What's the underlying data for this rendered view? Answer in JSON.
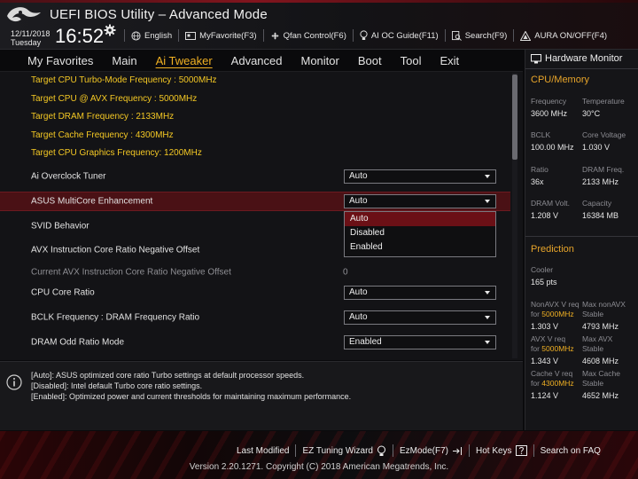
{
  "header": {
    "title": "UEFI BIOS Utility – Advanced Mode",
    "date": "12/11/2018",
    "day": "Tuesday",
    "time": "16:52",
    "items": [
      {
        "label": "English",
        "icon": "globe-icon"
      },
      {
        "label": "MyFavorite(F3)",
        "icon": "favorite-icon"
      },
      {
        "label": "Qfan Control(F6)",
        "icon": "fan-icon"
      },
      {
        "label": "AI OC Guide(F11)",
        "icon": "bulb-icon"
      },
      {
        "label": "Search(F9)",
        "icon": "search-icon"
      },
      {
        "label": "AURA ON/OFF(F4)",
        "icon": "aura-icon"
      }
    ]
  },
  "nav": {
    "tabs": [
      "My Favorites",
      "Main",
      "Ai Tweaker",
      "Advanced",
      "Monitor",
      "Boot",
      "Tool",
      "Exit"
    ],
    "active": "Ai Tweaker"
  },
  "main": {
    "info_lines": [
      "Target CPU Turbo-Mode Frequency : 5000MHz",
      "Target CPU @ AVX Frequency : 5000MHz",
      "Target DRAM Frequency : 2133MHz",
      "Target Cache Frequency : 4300MHz",
      "Target CPU Graphics Frequency: 1200MHz"
    ],
    "settings": [
      {
        "label": "Ai Overclock Tuner",
        "value": "Auto"
      },
      {
        "label": "ASUS MultiCore Enhancement",
        "value": "Auto"
      },
      {
        "label": "SVID Behavior",
        "value": ""
      },
      {
        "label": "AVX Instruction Core Ratio Negative Offset",
        "value": ""
      },
      {
        "label": "Current AVX Instruction Core Ratio Negative Offset",
        "value": "0"
      },
      {
        "label": "CPU Core Ratio",
        "value": "Auto"
      },
      {
        "label": "BCLK Frequency : DRAM Frequency Ratio",
        "value": "Auto"
      },
      {
        "label": "DRAM Odd Ratio Mode",
        "value": "Enabled"
      }
    ],
    "dropdown_options": [
      "Auto",
      "Disabled",
      "Enabled"
    ],
    "dropdown_selected": "Auto"
  },
  "help": [
    "[Auto]: ASUS optimized core ratio Turbo settings at default processor speeds.",
    "[Disabled]: Intel default Turbo core ratio settings.",
    "[Enabled]: Optimized power and current thresholds for maintaining maximum performance."
  ],
  "hw_monitor": {
    "title": "Hardware Monitor",
    "cpu_memory_label": "CPU/Memory",
    "cpu": [
      {
        "k": "Frequency",
        "v": "3600 MHz"
      },
      {
        "k": "Temperature",
        "v": "30°C"
      },
      {
        "k": "BCLK",
        "v": "100.00 MHz"
      },
      {
        "k": "Core Voltage",
        "v": "1.030 V"
      },
      {
        "k": "Ratio",
        "v": "36x"
      },
      {
        "k": "DRAM Freq.",
        "v": "2133 MHz"
      },
      {
        "k": "DRAM Volt.",
        "v": "1.208 V"
      },
      {
        "k": "Capacity",
        "v": "16384 MB"
      }
    ],
    "prediction_label": "Prediction",
    "cooler_label": "Cooler",
    "cooler_value": "165 pts",
    "pred": [
      {
        "k1": "NonAVX V req",
        "k2": "for ",
        "k2hl": "5000MHz",
        "v": "1.303 V"
      },
      {
        "k1": "Max nonAVX",
        "k2": "Stable",
        "k2hl": "",
        "v": "4793 MHz"
      },
      {
        "k1": "AVX V req",
        "k2": "for ",
        "k2hl": "5000MHz",
        "v": "1.343 V"
      },
      {
        "k1": "Max AVX",
        "k2": "Stable",
        "k2hl": "",
        "v": "4608 MHz"
      },
      {
        "k1": "Cache V req",
        "k2": "for ",
        "k2hl": "4300MHz",
        "v": "1.124 V"
      },
      {
        "k1": "Max Cache",
        "k2": "Stable",
        "k2hl": "",
        "v": "4652 MHz"
      }
    ]
  },
  "footer": {
    "items": [
      "Last Modified",
      "EZ Tuning Wizard",
      "EzMode(F7)",
      "Hot Keys",
      "Search on FAQ"
    ],
    "copyright": "Version 2.20.1271. Copyright (C) 2018 American Megatrends, Inc."
  },
  "colors": {
    "accent": "#f0b023",
    "select_row": "#4a1115",
    "yellow_text": "#f4c824"
  }
}
